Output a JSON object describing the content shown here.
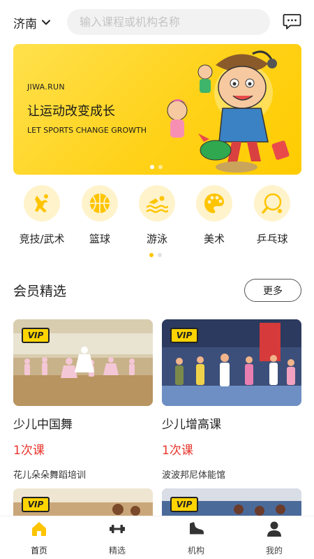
{
  "header": {
    "city": "济南",
    "search_placeholder": "输入课程或机构名称"
  },
  "banner": {
    "site": "JIWA.RUN",
    "slogan": "让运动改变成长",
    "slogan_en": "LET SPORTS CHANGE GROWTH",
    "page_count": 2,
    "active_page": 1
  },
  "categories": [
    {
      "label": "竞技/武术",
      "icon": "martial-arts-icon"
    },
    {
      "label": "篮球",
      "icon": "basketball-icon"
    },
    {
      "label": "游泳",
      "icon": "swimming-icon"
    },
    {
      "label": "美术",
      "icon": "palette-icon"
    },
    {
      "label": "乒乓球",
      "icon": "table-tennis-icon"
    }
  ],
  "section": {
    "title": "会员精选",
    "more": "更多"
  },
  "courses": [
    {
      "badge": "VIP",
      "title": "少儿中国舞",
      "lessons": "1次课",
      "org": "花儿朵朵舞蹈培训"
    },
    {
      "badge": "VIP",
      "title": "少儿增高课",
      "lessons": "1次课",
      "org": "波波邦尼体能馆"
    },
    {
      "badge": "VIP"
    },
    {
      "badge": "VIP"
    }
  ],
  "tabs": [
    {
      "label": "首页",
      "icon": "home-icon",
      "active": true
    },
    {
      "label": "精选",
      "icon": "dumbbell-icon",
      "active": false
    },
    {
      "label": "机构",
      "icon": "sneaker-icon",
      "active": false
    },
    {
      "label": "我的",
      "icon": "user-icon",
      "active": false
    }
  ],
  "colors": {
    "accent": "#ffc400",
    "price": "#e8342b",
    "category_bg": "#fff3cc"
  }
}
